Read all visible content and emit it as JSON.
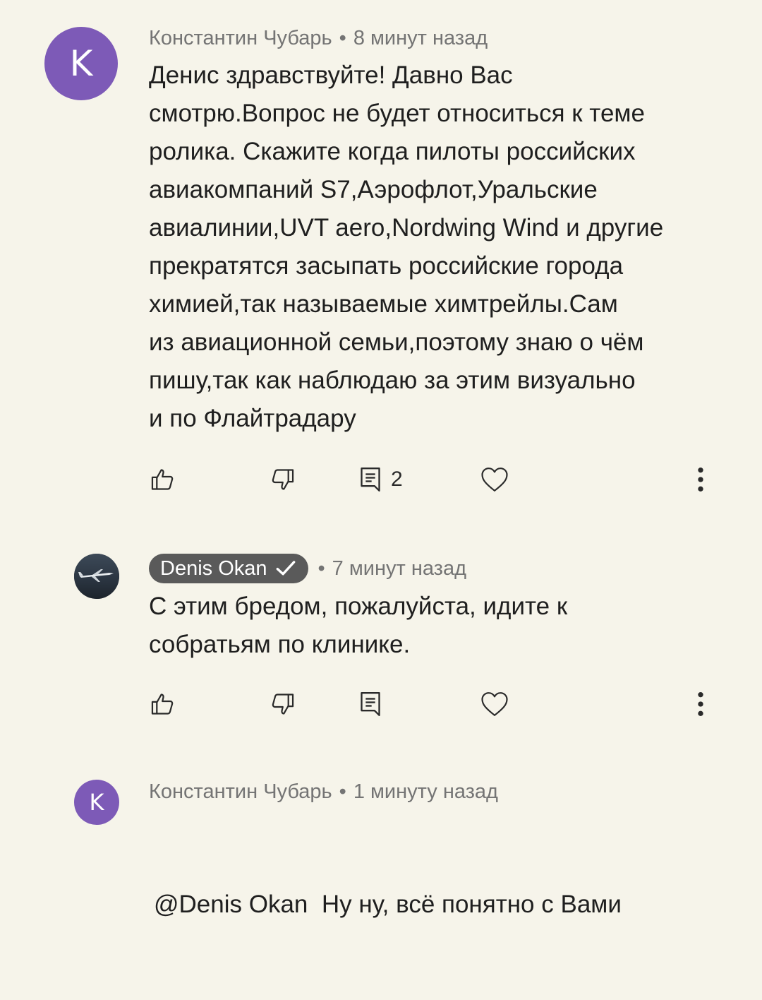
{
  "colors": {
    "background": "#f6f4ea",
    "avatar_letter_bg": "#7d5ab7",
    "badge_bg": "#5a5a5a",
    "meta_text": "#747474"
  },
  "comments": [
    {
      "avatar_letter": "K",
      "author": "Константин Чубарь",
      "time": "8 минут назад",
      "lines": [
        "Денис здравствуйте! Давно Вас",
        "смотрю.Вопрос не будет относиться к теме",
        "ролика. Скажите когда пилоты российских",
        "авиакомпаний S7,Аэрофлот,Уральские",
        "авиалинии,UVT aero,Nordwing Wind и другие",
        "прекратятся засыпать российские города",
        "химией,так называемые химтрейлы.Сам",
        "из авиационной семьи,поэтому знаю о чём",
        "пишу,так как наблюдаю за этим визуально",
        "и по Флайтрадару"
      ],
      "reply_count": "2",
      "icons": [
        "like-icon",
        "dislike-icon",
        "reply-icon",
        "heart-icon",
        "more-vert-icon"
      ]
    },
    {
      "author": "Denis Okan",
      "verified": true,
      "time": "7 минут назад",
      "lines": [
        "С этим бредом, пожалуйста, идите к",
        "собратьям по клинике."
      ],
      "icons": [
        "like-icon",
        "dislike-icon",
        "reply-icon",
        "heart-icon",
        "more-vert-icon"
      ]
    },
    {
      "avatar_letter": "K",
      "author": "Константин Чубарь",
      "time": "1 минуту назад",
      "lines": [
        "@Denis Okan  Ну ну, всё понятно с Вами"
      ]
    }
  ]
}
